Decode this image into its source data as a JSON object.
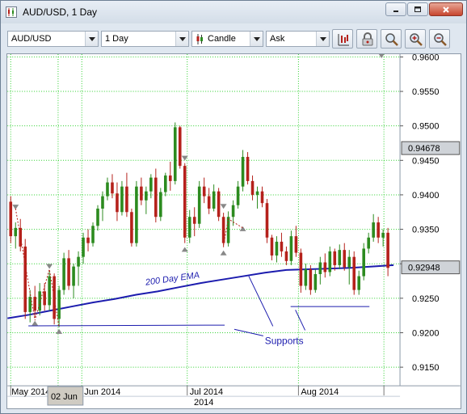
{
  "window": {
    "title": "AUD/USD,  1 Day"
  },
  "toolbar": {
    "symbol": "AUD/USD",
    "period": "1 Day",
    "chart_type": "Candle",
    "price_side": "Ask"
  },
  "chart_data": {
    "type": "candlestick",
    "title": "",
    "xlabel": "",
    "ylabel": "",
    "ylim": [
      0.9123,
      0.9604
    ],
    "y_ticks": [
      "0.9600",
      "0.9550",
      "0.9500",
      "0.9450",
      "0.9400",
      "0.9350",
      "0.9300",
      "0.9250",
      "0.9200",
      "0.9150"
    ],
    "x_ticks": [
      "May 2014",
      "Jun 2014",
      "Jul 2014",
      "Aug 2014"
    ],
    "x_period_label": "2014",
    "crosshair_date_label": "02 Jun",
    "price_labels": [
      {
        "value": 0.94678,
        "text": "0.94678"
      },
      {
        "value": 0.92948,
        "text": "0.92948"
      }
    ],
    "grid": true,
    "up_color": "#2c8b1f",
    "down_color": "#b5211b",
    "candles": [
      [
        0.939,
        0.9398,
        0.933,
        0.934
      ],
      [
        0.934,
        0.936,
        0.9322,
        0.9352
      ],
      [
        0.9352,
        0.9365,
        0.9318,
        0.9325
      ],
      [
        0.9325,
        0.9336,
        0.922,
        0.923
      ],
      [
        0.923,
        0.9262,
        0.9215,
        0.9252
      ],
      [
        0.9252,
        0.9268,
        0.9222,
        0.9232
      ],
      [
        0.9232,
        0.9272,
        0.9225,
        0.926
      ],
      [
        0.926,
        0.9272,
        0.9232,
        0.924
      ],
      [
        0.924,
        0.929,
        0.9232,
        0.9282
      ],
      [
        0.9282,
        0.9286,
        0.9212,
        0.922
      ],
      [
        0.922,
        0.9268,
        0.9208,
        0.9262
      ],
      [
        0.9262,
        0.9316,
        0.9255,
        0.9308
      ],
      [
        0.9308,
        0.932,
        0.9262,
        0.9268
      ],
      [
        0.9268,
        0.93,
        0.925,
        0.9296
      ],
      [
        0.9296,
        0.9318,
        0.9268,
        0.931
      ],
      [
        0.931,
        0.9345,
        0.93,
        0.9338
      ],
      [
        0.9338,
        0.935,
        0.9318,
        0.933
      ],
      [
        0.933,
        0.936,
        0.9325,
        0.9355
      ],
      [
        0.9355,
        0.9385,
        0.9348,
        0.938
      ],
      [
        0.938,
        0.9405,
        0.9362,
        0.9398
      ],
      [
        0.9398,
        0.9425,
        0.9392,
        0.9418
      ],
      [
        0.9418,
        0.943,
        0.9395,
        0.9402
      ],
      [
        0.9402,
        0.9418,
        0.9362,
        0.9375
      ],
      [
        0.9375,
        0.942,
        0.937,
        0.9412
      ],
      [
        0.9412,
        0.9432,
        0.9368,
        0.9375
      ],
      [
        0.9375,
        0.938,
        0.9325,
        0.933
      ],
      [
        0.933,
        0.942,
        0.9325,
        0.9412
      ],
      [
        0.9412,
        0.9425,
        0.9385,
        0.9392
      ],
      [
        0.9392,
        0.9412,
        0.9372,
        0.9405
      ],
      [
        0.9405,
        0.943,
        0.9395,
        0.9425
      ],
      [
        0.9425,
        0.9438,
        0.936,
        0.9368
      ],
      [
        0.9368,
        0.941,
        0.9362,
        0.9404
      ],
      [
        0.9404,
        0.9432,
        0.9398,
        0.9428
      ],
      [
        0.9428,
        0.9448,
        0.9406,
        0.942
      ],
      [
        0.942,
        0.9505,
        0.9415,
        0.9498
      ],
      [
        0.9498,
        0.95,
        0.9438,
        0.9442
      ],
      [
        0.9442,
        0.9446,
        0.933,
        0.9338
      ],
      [
        0.9338,
        0.9378,
        0.933,
        0.9368
      ],
      [
        0.9368,
        0.9382,
        0.934,
        0.9358
      ],
      [
        0.9358,
        0.942,
        0.9352,
        0.9412
      ],
      [
        0.9412,
        0.9425,
        0.9388,
        0.9398
      ],
      [
        0.9398,
        0.941,
        0.9372,
        0.938
      ],
      [
        0.938,
        0.9415,
        0.9376,
        0.9405
      ],
      [
        0.9405,
        0.941,
        0.9362,
        0.9368
      ],
      [
        0.9368,
        0.9374,
        0.9324,
        0.933
      ],
      [
        0.933,
        0.9376,
        0.9325,
        0.9368
      ],
      [
        0.9368,
        0.9392,
        0.9355,
        0.9385
      ],
      [
        0.9385,
        0.942,
        0.938,
        0.9412
      ],
      [
        0.9412,
        0.9465,
        0.9405,
        0.9455
      ],
      [
        0.9455,
        0.9462,
        0.9415,
        0.942
      ],
      [
        0.942,
        0.9428,
        0.9392,
        0.94
      ],
      [
        0.94,
        0.9412,
        0.938,
        0.9405
      ],
      [
        0.9405,
        0.9412,
        0.9382,
        0.9388
      ],
      [
        0.9388,
        0.9394,
        0.933,
        0.9338
      ],
      [
        0.9338,
        0.9342,
        0.9305,
        0.9312
      ],
      [
        0.9312,
        0.934,
        0.9302,
        0.9332
      ],
      [
        0.9332,
        0.9345,
        0.931,
        0.9318
      ],
      [
        0.9318,
        0.9325,
        0.9298,
        0.9304
      ],
      [
        0.9304,
        0.9348,
        0.9298,
        0.934
      ],
      [
        0.934,
        0.9355,
        0.931,
        0.9316
      ],
      [
        0.9316,
        0.9322,
        0.9258,
        0.9268
      ],
      [
        0.9268,
        0.93,
        0.9262,
        0.9292
      ],
      [
        0.9292,
        0.9298,
        0.9255,
        0.9262
      ],
      [
        0.9262,
        0.9292,
        0.9258,
        0.9285
      ],
      [
        0.9285,
        0.931,
        0.927,
        0.9302
      ],
      [
        0.9302,
        0.9315,
        0.928,
        0.9288
      ],
      [
        0.9288,
        0.9325,
        0.9282,
        0.9318
      ],
      [
        0.9318,
        0.9322,
        0.929,
        0.9298
      ],
      [
        0.9298,
        0.9328,
        0.9292,
        0.932
      ],
      [
        0.932,
        0.933,
        0.929,
        0.9295
      ],
      [
        0.9295,
        0.932,
        0.927,
        0.931
      ],
      [
        0.931,
        0.9318,
        0.9255,
        0.9262
      ],
      [
        0.9262,
        0.929,
        0.9255,
        0.9282
      ],
      [
        0.9282,
        0.933,
        0.9276,
        0.9322
      ],
      [
        0.9322,
        0.9345,
        0.9315,
        0.9338
      ],
      [
        0.9338,
        0.9372,
        0.9332,
        0.936
      ],
      [
        0.936,
        0.9368,
        0.933,
        0.9338
      ],
      [
        0.9338,
        0.935,
        0.9325,
        0.9345
      ],
      [
        0.9345,
        0.9352,
        0.9282,
        0.9294
      ]
    ],
    "ema": {
      "name": "200 Day EMA",
      "color": "#1c1cae",
      "values": [
        0.9221,
        0.9226,
        0.9232,
        0.9238,
        0.9244,
        0.9249,
        0.9255,
        0.926,
        0.9266,
        0.9272,
        0.9277,
        0.9282,
        0.9287,
        0.9291,
        0.9292,
        0.9293,
        0.9294,
        0.9296,
        0.9298
      ]
    },
    "annotations": {
      "ema_label": "200 Day EMA",
      "supports_label": "Supports",
      "color": "#1c1cae"
    }
  }
}
